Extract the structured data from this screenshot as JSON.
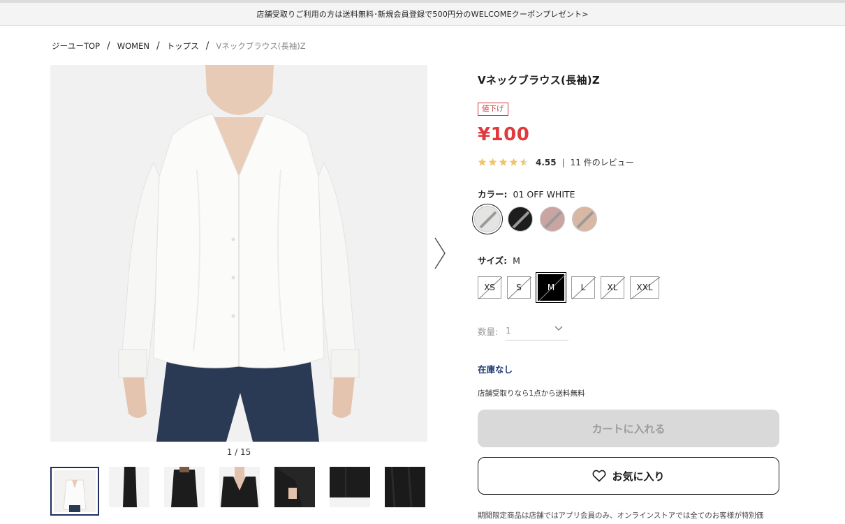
{
  "banner": {
    "text": "店舗受取りご利用の方は送料無料･新規会員登録で500円分のWELCOMEクーポンプレゼント>"
  },
  "breadcrumb": [
    {
      "label": "ジーユーTOP"
    },
    {
      "label": "WOMEN"
    },
    {
      "label": "トップス"
    },
    {
      "label": "Vネックブラウス(長袖)Z"
    }
  ],
  "breadcrumb_separator": "/",
  "gallery": {
    "counter": "1 / 15",
    "next_icon": "chevron-right-icon",
    "thumbnails": [
      {
        "name": "white-front",
        "color": "#f3f2f0",
        "active": true
      },
      {
        "name": "black-side",
        "color": "#1c1c1c",
        "active": false
      },
      {
        "name": "black-back",
        "color": "#1c1c1c",
        "active": false
      },
      {
        "name": "black-front-neck",
        "color": "#1c1c1c",
        "active": false
      },
      {
        "name": "black-sleeve",
        "color": "#1c1c1c",
        "active": false
      },
      {
        "name": "black-hem",
        "color": "#1c1c1c",
        "active": false
      },
      {
        "name": "black-detail",
        "color": "#1c1c1c",
        "active": false
      }
    ]
  },
  "product": {
    "title": "Vネックブラウス(長袖)Z",
    "badge": "値下げ",
    "price": "¥100",
    "rating": {
      "score": "4.55",
      "stars": 4.55,
      "divider": "|",
      "reviews": "11 件のレビュー"
    },
    "color": {
      "label": "カラー:",
      "value": "01 OFF WHITE",
      "swatches": [
        {
          "name": "off-white",
          "hex": "#e4e4e2",
          "selected": true
        },
        {
          "name": "black",
          "hex": "#1d1d1d",
          "selected": false
        },
        {
          "name": "pink",
          "hex": "#c9a4a0",
          "selected": false
        },
        {
          "name": "beige",
          "hex": "#d8b8a2",
          "selected": false
        }
      ]
    },
    "size": {
      "label": "サイズ:",
      "value": "M",
      "options": [
        {
          "label": "XS",
          "selected": false
        },
        {
          "label": "S",
          "selected": false
        },
        {
          "label": "M",
          "selected": true
        },
        {
          "label": "L",
          "selected": false
        },
        {
          "label": "XL",
          "selected": false
        },
        {
          "label": "XXL",
          "selected": false
        }
      ]
    },
    "quantity": {
      "label": "数量:",
      "value": "1",
      "icon": "chevron-down-icon"
    },
    "stock": "在庫なし",
    "pickup_note": "店舗受取りなら1点から送料無料",
    "cart_button": "カートに入れる",
    "favorite_button": "お気に入り",
    "favorite_icon": "heart-icon",
    "footnote": "期間限定商品は店舗ではアプリ会員のみ、オンラインストアでは全てのお客様が特別価"
  },
  "colors": {
    "price": "#e0393e",
    "stock": "#1f3a72",
    "star": "#f0c468",
    "accent": "#1f2d5c"
  }
}
